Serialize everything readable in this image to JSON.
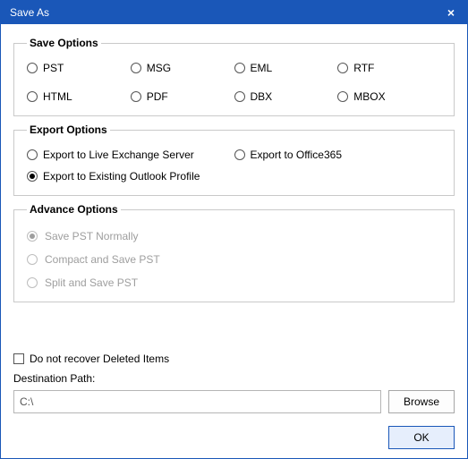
{
  "window": {
    "title": "Save As",
    "close_glyph": "×"
  },
  "saveOptions": {
    "legend": "Save Options",
    "formats": [
      "PST",
      "MSG",
      "EML",
      "RTF",
      "HTML",
      "PDF",
      "DBX",
      "MBOX"
    ],
    "selected": null
  },
  "exportOptions": {
    "legend": "Export Options",
    "liveExchange": "Export to Live Exchange Server",
    "office365": "Export to Office365",
    "existingProfile": "Export to Existing Outlook Profile",
    "selected": "existingProfile"
  },
  "advanceOptions": {
    "legend": "Advance Options",
    "saveNormally": "Save PST Normally",
    "compact": "Compact and Save PST",
    "split": "Split and Save PST",
    "selected": "saveNormally",
    "enabled": false
  },
  "deletedItems": {
    "label": "Do not recover Deleted Items",
    "checked": false
  },
  "destination": {
    "label": "Destination Path:",
    "value": "C:\\"
  },
  "buttons": {
    "browse": "Browse",
    "ok": "OK"
  }
}
